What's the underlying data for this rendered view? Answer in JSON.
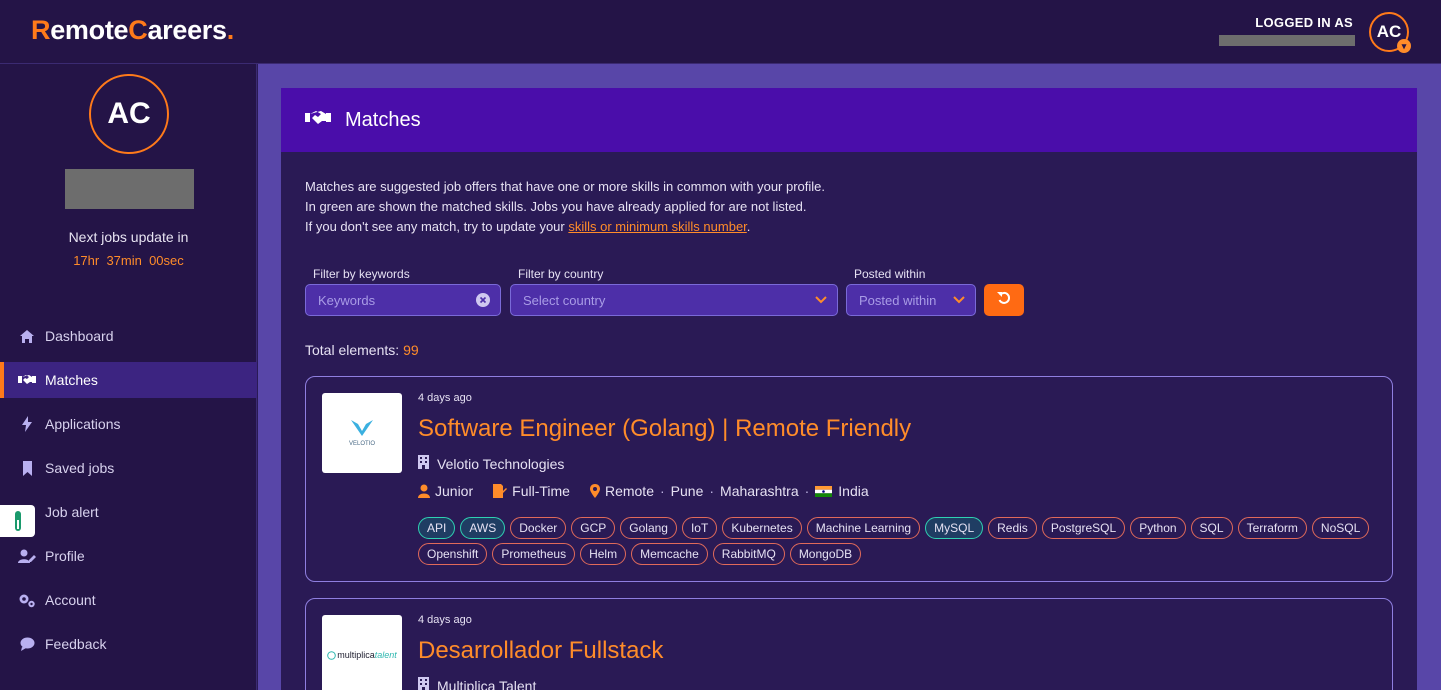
{
  "app": {
    "logo_parts": [
      "R",
      "emote",
      "C",
      "areers",
      "."
    ],
    "logged_in_label": "LOGGED IN AS",
    "avatar_initials": "AC"
  },
  "sidebar": {
    "avatar_initials": "AC",
    "next_update_label": "Next jobs update in",
    "countdown": "17hr  37min  00sec",
    "items": [
      {
        "label": "Dashboard",
        "icon": "home-icon",
        "active": false
      },
      {
        "label": "Matches",
        "icon": "handshake-icon",
        "active": true
      },
      {
        "label": "Applications",
        "icon": "bolt-icon",
        "active": false
      },
      {
        "label": "Saved jobs",
        "icon": "bookmark-icon",
        "active": false
      },
      {
        "label": "Job alert",
        "icon": "bell-icon",
        "active": false
      },
      {
        "label": "Profile",
        "icon": "user-edit-icon",
        "active": false
      },
      {
        "label": "Account",
        "icon": "gears-icon",
        "active": false
      },
      {
        "label": "Feedback",
        "icon": "comment-icon",
        "active": false
      }
    ]
  },
  "page": {
    "title": "Matches",
    "desc_line1": "Matches are suggested job offers that have one or more skills in common with your profile.",
    "desc_line2": "In green are shown the matched skills. Jobs you have already applied for are not listed.",
    "desc_line3_prefix": "If you don't see any match, try to update your ",
    "desc_link": "skills or minimum skills number",
    "desc_line3_suffix": "."
  },
  "filters": {
    "keywords_label": "Filter by keywords",
    "keywords_placeholder": "Keywords",
    "country_label": "Filter by country",
    "country_placeholder": "Select country",
    "posted_label": "Posted within",
    "posted_placeholder": "Posted within"
  },
  "results": {
    "total_label": "Total elements:",
    "total_value": "99"
  },
  "jobs": [
    {
      "logo_text": "VELOTIO",
      "posted": "4 days ago",
      "title": "Software Engineer (Golang) | Remote Friendly",
      "company": "Velotio Technologies",
      "level": "Junior",
      "type": "Full-Time",
      "location": [
        "Remote",
        "Pune",
        "Maharashtra"
      ],
      "country": "India",
      "tags": [
        {
          "name": "API",
          "matched": true
        },
        {
          "name": "AWS",
          "matched": true
        },
        {
          "name": "Docker",
          "matched": false
        },
        {
          "name": "GCP",
          "matched": false
        },
        {
          "name": "Golang",
          "matched": false
        },
        {
          "name": "IoT",
          "matched": false
        },
        {
          "name": "Kubernetes",
          "matched": false
        },
        {
          "name": "Machine Learning",
          "matched": false
        },
        {
          "name": "MySQL",
          "matched": true
        },
        {
          "name": "Redis",
          "matched": false
        },
        {
          "name": "PostgreSQL",
          "matched": false
        },
        {
          "name": "Python",
          "matched": false
        },
        {
          "name": "SQL",
          "matched": false
        },
        {
          "name": "Terraform",
          "matched": false
        },
        {
          "name": "NoSQL",
          "matched": false
        },
        {
          "name": "Openshift",
          "matched": false
        },
        {
          "name": "Prometheus",
          "matched": false
        },
        {
          "name": "Helm",
          "matched": false
        },
        {
          "name": "Memcache",
          "matched": false
        },
        {
          "name": "RabbitMQ",
          "matched": false
        },
        {
          "name": "MongoDB",
          "matched": false
        }
      ]
    },
    {
      "logo_text_a": "multiplica",
      "logo_text_b": "talent",
      "posted": "4 days ago",
      "title": "Desarrollador Fullstack",
      "company": "Multiplica Talent"
    }
  ],
  "colors": {
    "accent": "#ff7a1a",
    "match": "#2fd1b2",
    "header": "#4a0daa"
  }
}
